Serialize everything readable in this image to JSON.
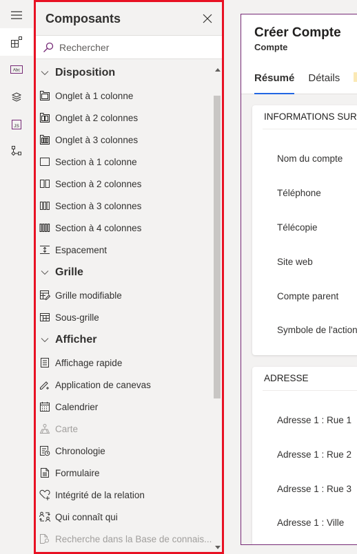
{
  "rail": {
    "items": [
      {
        "icon": "hamburger-menu-icon"
      },
      {
        "icon": "components-icon",
        "active": true
      },
      {
        "icon": "table-columns-icon"
      },
      {
        "icon": "layers-icon"
      },
      {
        "icon": "javascript-icon"
      },
      {
        "icon": "tree-view-icon"
      }
    ]
  },
  "panel": {
    "title": "Composants",
    "close_icon": "close-icon",
    "search": {
      "placeholder": "Rechercher",
      "value": ""
    },
    "groups": [
      {
        "label": "Disposition",
        "items": [
          {
            "label": "Onglet à 1 colonne",
            "icon": "tab-1-column-icon"
          },
          {
            "label": "Onglet à 2 colonnes",
            "icon": "tab-2-columns-icon"
          },
          {
            "label": "Onglet à 3 colonnes",
            "icon": "tab-3-columns-icon"
          },
          {
            "label": "Section à 1 colonne",
            "icon": "section-1-column-icon"
          },
          {
            "label": "Section à 2 colonnes",
            "icon": "section-2-columns-icon"
          },
          {
            "label": "Section à 3 colonnes",
            "icon": "section-3-columns-icon"
          },
          {
            "label": "Section à 4 colonnes",
            "icon": "section-4-columns-icon"
          },
          {
            "label": "Espacement",
            "icon": "spacer-icon"
          }
        ]
      },
      {
        "label": "Grille",
        "items": [
          {
            "label": "Grille modifiable",
            "icon": "editable-grid-icon"
          },
          {
            "label": "Sous-grille",
            "icon": "subgrid-icon"
          }
        ]
      },
      {
        "label": "Afficher",
        "items": [
          {
            "label": "Affichage rapide",
            "icon": "quick-view-icon"
          },
          {
            "label": "Application de canevas",
            "icon": "canvas-app-icon"
          },
          {
            "label": "Calendrier",
            "icon": "calendar-icon"
          },
          {
            "label": "Carte",
            "icon": "map-icon",
            "disabled": true
          },
          {
            "label": "Chronologie",
            "icon": "timeline-icon"
          },
          {
            "label": "Formulaire",
            "icon": "form-icon"
          },
          {
            "label": "Intégrité de la relation",
            "icon": "relationship-health-icon"
          },
          {
            "label": "Qui connaît qui",
            "icon": "who-knows-whom-icon"
          },
          {
            "label": "Recherche dans la Base de connais...",
            "icon": "knowledge-search-icon",
            "disabled": true
          }
        ]
      }
    ]
  },
  "form": {
    "title": "Créer Compte",
    "entity": "Compte",
    "tabs": [
      "Résumé",
      "Détails",
      ""
    ],
    "sections": [
      {
        "title": "INFORMATIONS SUR",
        "fields": [
          "Nom du compte",
          "Téléphone",
          "Télécopie",
          "Site web",
          "Compte parent",
          "Symbole de l'action"
        ]
      },
      {
        "title": "ADRESSE",
        "fields": [
          "Adresse 1 : Rue 1",
          "Adresse 1 : Rue 2",
          "Adresse 1 : Rue 3",
          "Adresse 1 : Ville"
        ]
      }
    ]
  },
  "colors": {
    "highlight_border": "#e81123",
    "accent": "#2266e3",
    "form_border": "#742774",
    "search_icon": "#742774"
  }
}
